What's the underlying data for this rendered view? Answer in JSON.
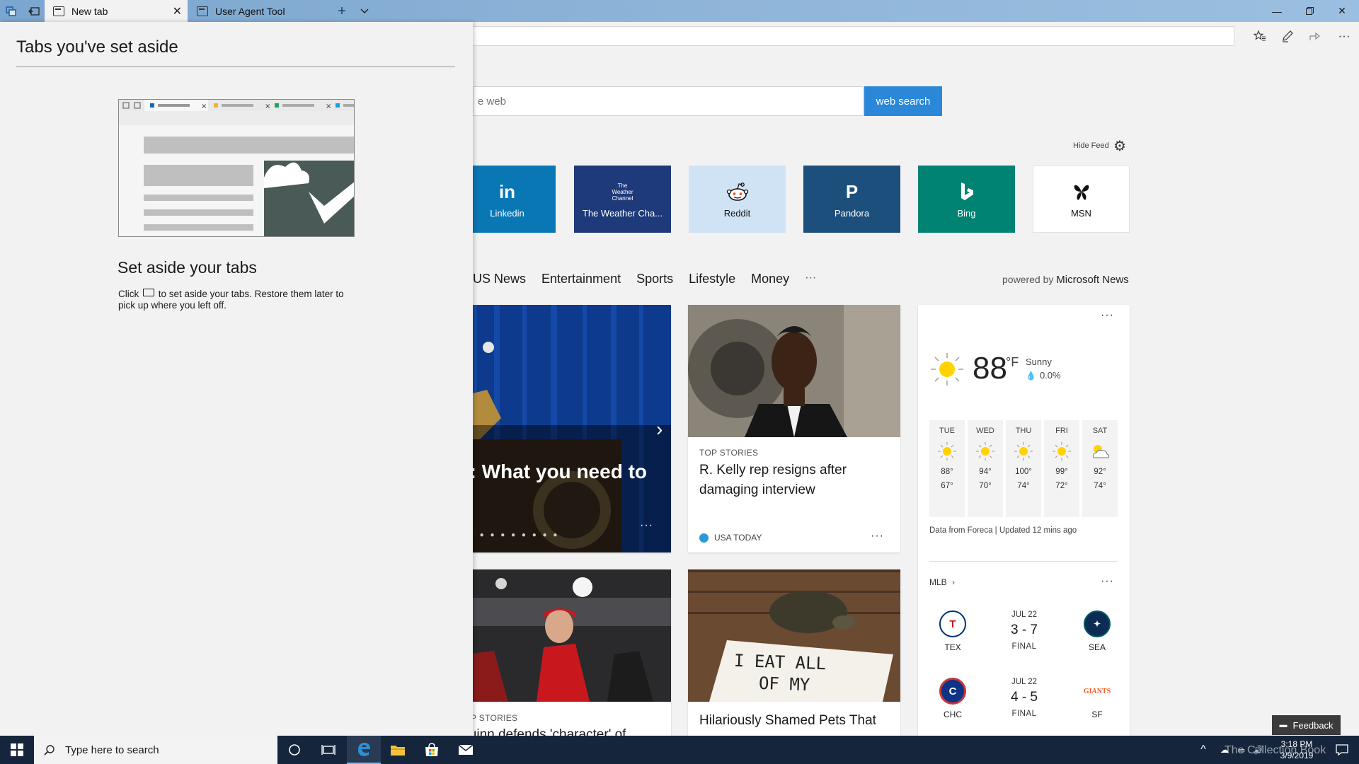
{
  "tabs": [
    {
      "label": "New tab",
      "active": true
    },
    {
      "label": "User Agent Tool",
      "active": false
    }
  ],
  "aside": {
    "title": "Tabs you've set aside",
    "heading": "Set aside your tabs",
    "body_prefix": "Click",
    "body_suffix": "to set aside your tabs. Restore them later to pick up where you left off."
  },
  "search": {
    "placeholder": "e web",
    "button_label": "web search"
  },
  "feed": {
    "hide_label": "Hide Feed"
  },
  "top_sites": [
    {
      "label": "Linkedin",
      "glyph": "in",
      "color": "#0a77b5"
    },
    {
      "label": "The Weather Cha...",
      "glyph": "The Weather Channel",
      "color": "#1e3a7a"
    },
    {
      "label": "Reddit",
      "glyph": "reddit-alien",
      "color": "#cfe3f5"
    },
    {
      "label": "Pandora",
      "glyph": "P",
      "color": "#1d4f7c"
    },
    {
      "label": "Bing",
      "glyph": "b",
      "color": "#008373"
    },
    {
      "label": "MSN",
      "glyph": "butterfly",
      "color": "#ffffff"
    }
  ],
  "news_nav": [
    "US News",
    "Entertainment",
    "Sports",
    "Lifestyle",
    "Money",
    "···"
  ],
  "powered_by": {
    "prefix": "powered by",
    "brand": "Microsoft News"
  },
  "cards": {
    "hero": {
      "title": "v: What you need to"
    },
    "kelly": {
      "category": "TOP STORIES",
      "title": "R. Kelly rep resigns after damaging interview",
      "source": "USA TODAY"
    },
    "football": {
      "category": "TOP STORIES",
      "title": "Quinn defends 'character' of"
    },
    "pets": {
      "sign_line1": "I EAT ALL",
      "sign_line2": "OF MY",
      "title": "Hilariously Shamed Pets That"
    }
  },
  "weather": {
    "temp": "88",
    "unit": "°F",
    "condition": "Sunny",
    "precip": "0.0%",
    "forecast": [
      {
        "day": "TUE",
        "high": "88°",
        "low": "67°",
        "icon": "sun-icon"
      },
      {
        "day": "WED",
        "high": "94°",
        "low": "70°",
        "icon": "sun-icon"
      },
      {
        "day": "THU",
        "high": "100°",
        "low": "74°",
        "icon": "sun-icon"
      },
      {
        "day": "FRI",
        "high": "99°",
        "low": "72°",
        "icon": "sun-icon"
      },
      {
        "day": "SAT",
        "high": "92°",
        "low": "74°",
        "icon": "partly-cloudy-icon"
      }
    ],
    "source_note": "Data from Foreca | Updated 12 mins ago"
  },
  "mlb": {
    "label": "MLB",
    "games": [
      {
        "home": "TEX",
        "away": "SEA",
        "date": "JUL 22",
        "score": "3 - 7",
        "status": "FINAL"
      },
      {
        "home": "CHC",
        "away": "SF",
        "date": "JUL 22",
        "score": "4 - 5",
        "status": "FINAL"
      }
    ]
  },
  "feedback_label": "Feedback",
  "taskbar": {
    "search_placeholder": "Type here to search",
    "time": "3:18 PM",
    "date": "3/9/2019",
    "watermark": "The Collection Book"
  }
}
